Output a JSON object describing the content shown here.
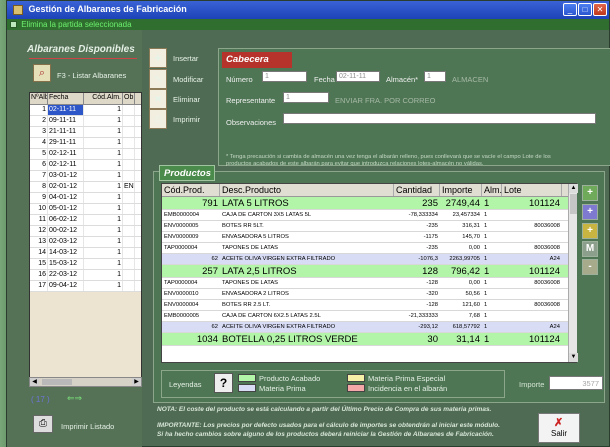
{
  "window": {
    "title": "Gestión de Albaranes de Fabricación",
    "btn_min": "_",
    "btn_max": "□",
    "btn_close": "✕"
  },
  "status": {
    "message": "Elimina la partida seleccionada"
  },
  "left": {
    "title": "Albaranes Disponibles",
    "f3_label": "F3 - Listar Albaranes",
    "f3_icon": "search-icon",
    "headers": [
      "NºAlb.",
      "Fecha",
      "Cód.Alm.",
      "Ob"
    ],
    "rows": [
      {
        "n": "1",
        "fecha": "02-11-11",
        "alm": "1",
        "ob": ""
      },
      {
        "n": "2",
        "fecha": "09-11-11",
        "alm": "1",
        "ob": ""
      },
      {
        "n": "3",
        "fecha": "21-11-11",
        "alm": "1",
        "ob": ""
      },
      {
        "n": "4",
        "fecha": "29-11-11",
        "alm": "1",
        "ob": ""
      },
      {
        "n": "5",
        "fecha": "02-12-11",
        "alm": "1",
        "ob": ""
      },
      {
        "n": "6",
        "fecha": "02-12-11",
        "alm": "1",
        "ob": ""
      },
      {
        "n": "7",
        "fecha": "03-01-12",
        "alm": "1",
        "ob": ""
      },
      {
        "n": "8",
        "fecha": "02-01-12",
        "alm": "1",
        "ob": "ENV"
      },
      {
        "n": "9",
        "fecha": "04-01-12",
        "alm": "1",
        "ob": ""
      },
      {
        "n": "10",
        "fecha": "05-01-12",
        "alm": "1",
        "ob": ""
      },
      {
        "n": "11",
        "fecha": "06-02-12",
        "alm": "1",
        "ob": ""
      },
      {
        "n": "12",
        "fecha": "00-02-12",
        "alm": "1",
        "ob": ""
      },
      {
        "n": "13",
        "fecha": "02-03-12",
        "alm": "1",
        "ob": ""
      },
      {
        "n": "14",
        "fecha": "14-03-12",
        "alm": "1",
        "ob": ""
      },
      {
        "n": "15",
        "fecha": "15-03-12",
        "alm": "1",
        "ob": ""
      },
      {
        "n": "16",
        "fecha": "22-03-12",
        "alm": "1",
        "ob": ""
      },
      {
        "n": "17",
        "fecha": "09-04-12",
        "alm": "1",
        "ob": ""
      }
    ],
    "count": "( 17 )",
    "print_label": "Imprimir Listado"
  },
  "toolbar": {
    "insertar": "Insertar",
    "modificar": "Modificar",
    "eliminar": "Eliminar",
    "imprimir": "Imprimir"
  },
  "cabecera": {
    "tab": "Cabecera",
    "numero_label": "Número",
    "numero_value": "1",
    "fecha_label": "Fecha",
    "fecha_value": "02-11-11",
    "almacen_label": "Almacén*",
    "almacen_value": "1",
    "almacen_name": "ALMACEN",
    "representante_label": "Representante",
    "representante_value": "1",
    "representante_name": "ENVIAR FRA. POR CORREO",
    "observaciones_label": "Observaciones",
    "note_line1": "* Tenga precaución si cambia de almacén una vez tenga el albarán relleno, pues conllevará que se vacíe el campo Lote de los",
    "note_line2": "productos acabados de este albarán para evitar que introduzca relaciones lotes-almacén no válidas."
  },
  "productos": {
    "tab": "Productos",
    "headers": [
      "Cód.Prod.",
      "Desc.Producto",
      "Cantidad",
      "Importe",
      "Alm.",
      "Lote"
    ],
    "rows": [
      {
        "type": "prod",
        "cod": "791",
        "desc": "LATA 5 LITROS",
        "cant": "235",
        "imp": "2749,44",
        "alm": "1",
        "lote": "101124"
      },
      {
        "type": "mp",
        "cod": "EMB0000004",
        "desc": "CAJA DE CARTON 3X5 LATAS 5L",
        "cant": "-78,333334",
        "imp": "23,457334",
        "alm": "1",
        "lote": ""
      },
      {
        "type": "mp",
        "cod": "ENV0000005",
        "desc": "BOTES RR 5LT.",
        "cant": "-235",
        "imp": "316,31",
        "alm": "1",
        "lote": "80036008"
      },
      {
        "type": "mp",
        "cod": "ENV0000009",
        "desc": "ENVASADORA 5 LITROS",
        "cant": "-1175",
        "imp": "145,70",
        "alm": "1",
        "lote": ""
      },
      {
        "type": "mp",
        "cod": "TAP0000004",
        "desc": "TAPONES DE LATAS",
        "cant": "-235",
        "imp": "0,00",
        "alm": "1",
        "lote": "80036008"
      },
      {
        "type": "alt",
        "cod": "62",
        "desc": "ACEITE OLIVA VIRGEN EXTRA FILTRADO",
        "cant": "-1076,3",
        "imp": "2263,99705",
        "alm": "1",
        "lote": "A24"
      },
      {
        "type": "prod",
        "cod": "257",
        "desc": "LATA 2,5 LITROS",
        "cant": "128",
        "imp": "796,42",
        "alm": "1",
        "lote": "101124"
      },
      {
        "type": "mp",
        "cod": "TAP0000004",
        "desc": "TAPONES DE LATAS",
        "cant": "-128",
        "imp": "0,00",
        "alm": "1",
        "lote": "80036008"
      },
      {
        "type": "mp",
        "cod": "ENV0000010",
        "desc": "ENVASADORA 2 LITROS",
        "cant": "-320",
        "imp": "50,56",
        "alm": "1",
        "lote": ""
      },
      {
        "type": "mp",
        "cod": "ENV0000004",
        "desc": "BOTES RR 2.5 LT.",
        "cant": "-128",
        "imp": "121,60",
        "alm": "1",
        "lote": "80036008"
      },
      {
        "type": "mp",
        "cod": "EMB0000005",
        "desc": "CAJA DE CARTON 6X2.5 LATAS 2.5L",
        "cant": "-21,333333",
        "imp": "7,68",
        "alm": "1",
        "lote": ""
      },
      {
        "type": "alt",
        "cod": "62",
        "desc": "ACEITE OLIVA VIRGEN EXTRA FILTRADO",
        "cant": "-293,12",
        "imp": "618,57792",
        "alm": "1",
        "lote": "A24"
      },
      {
        "type": "prod",
        "cod": "1034",
        "desc": "BOTELLA 0,25 LITROS VERDE",
        "cant": "30",
        "imp": "31,14",
        "alm": "1",
        "lote": "101124"
      }
    ],
    "side_buttons": [
      "+",
      "+",
      "+",
      "M",
      "-"
    ],
    "legend_label": "Leyendas",
    "legend_help": "?",
    "legend": {
      "producto_acabado": "Producto Acabado",
      "materia_prima": "Materia Prima",
      "mp_especial": "Materia Prima Especial",
      "incidencia": "Incidencia en el albarán"
    },
    "colors": {
      "producto_acabado": "#b2f5a8",
      "materia_prima": "#d8dcf5",
      "mp_especial": "#f5efa8",
      "incidencia": "#f5a8a8"
    },
    "importe_label": "Importe",
    "importe_value": "3577"
  },
  "footer": {
    "note1": "NOTA: El coste del producto se está calculando a partir del Último Precio de Compra de sus materia primas.",
    "note2": "IMPORTANTE: Los precios por defecto usados para el cálculo de importes se obtendrán al iniciar este módulo.",
    "note3": "Si ha hecho cambios sobre alguno de los productos deberá reiniciar la Gestión de Albaranes de Fabricación."
  },
  "salir": "Salir"
}
